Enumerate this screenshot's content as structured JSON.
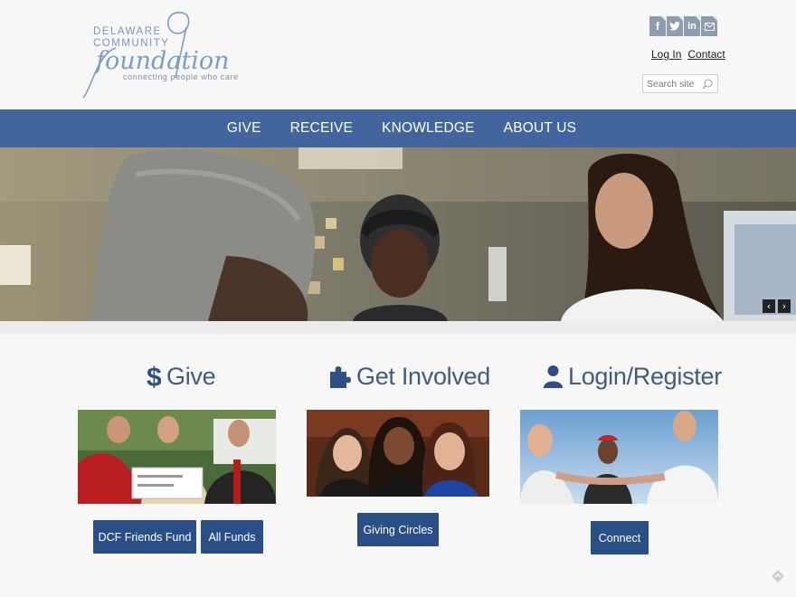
{
  "header": {
    "logo": {
      "line1": "DELAWARE",
      "line2": "COMMUNITY",
      "script": "foundation",
      "tagline": "connecting people who care"
    },
    "social": [
      {
        "name": "facebook-icon",
        "glyph": "f"
      },
      {
        "name": "twitter-icon",
        "glyph": "t"
      },
      {
        "name": "linkedin-icon",
        "glyph": "in"
      },
      {
        "name": "email-icon",
        "glyph": "✉"
      }
    ],
    "links": {
      "login": "Log In",
      "contact": "Contact"
    },
    "search": {
      "placeholder": "Search site"
    }
  },
  "nav": {
    "items": [
      "GIVE",
      "RECEIVE",
      "KNOWLEDGE",
      "ABOUT US"
    ]
  },
  "hero": {
    "prev": "‹",
    "next": "›"
  },
  "columns": [
    {
      "title": "Give",
      "buttons": [
        "DCF Friends Fund",
        "All Funds"
      ]
    },
    {
      "title": "Get Involved",
      "buttons": [
        "Giving Circles"
      ]
    },
    {
      "title": "Login/Register",
      "buttons": [
        "Connect"
      ]
    }
  ],
  "colors": {
    "nav": "#42659e",
    "button": "#2a4f87",
    "title": "#445a7e",
    "icon": "#2e4f86"
  }
}
